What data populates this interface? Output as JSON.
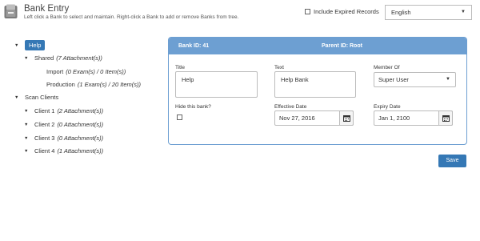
{
  "header": {
    "title": "Bank Entry",
    "subtitle": "Left click a Bank to select and maintain. Right-click a Bank to add or remove Banks from tree.",
    "include_expired_label": "Include Expired Records",
    "include_expired_checked": false,
    "language": "English"
  },
  "tree": {
    "help": {
      "label": "Help"
    },
    "shared": {
      "label": "Shared",
      "meta": "(7 Attachment(s))"
    },
    "import": {
      "label": "Import",
      "meta": "(0 Exam(s) / 0 Item(s))"
    },
    "production": {
      "label": "Production",
      "meta": "(1 Exam(s) / 20 Item(s))"
    },
    "scan_clients": {
      "label": "Scan Clients"
    },
    "client1": {
      "label": "Client 1",
      "meta": "(2 Attachment(s))"
    },
    "client2": {
      "label": "Client 2",
      "meta": "(0 Attachment(s))"
    },
    "client3": {
      "label": "Client 3",
      "meta": "(0 Attachment(s))"
    },
    "client4": {
      "label": "Client 4",
      "meta": "(1 Attachment(s))"
    }
  },
  "panel": {
    "bank_id": "Bank ID: 41",
    "parent_id": "Parent ID: Root",
    "title_label": "Title",
    "title_value": "Help",
    "text_label": "Text",
    "text_value": "Help Bank",
    "member_label": "Member Of",
    "member_value": "Super User",
    "hide_label": "Hide this bank?",
    "hide_checked": false,
    "effective_label": "Effective Date",
    "effective_value": "Nov 27, 2016",
    "expiry_label": "Expiry Date",
    "expiry_value": "Jan 1, 2100"
  },
  "actions": {
    "save_label": "Save"
  },
  "colors": {
    "accent": "#3578b5",
    "panel_header": "#6d9fd2"
  }
}
